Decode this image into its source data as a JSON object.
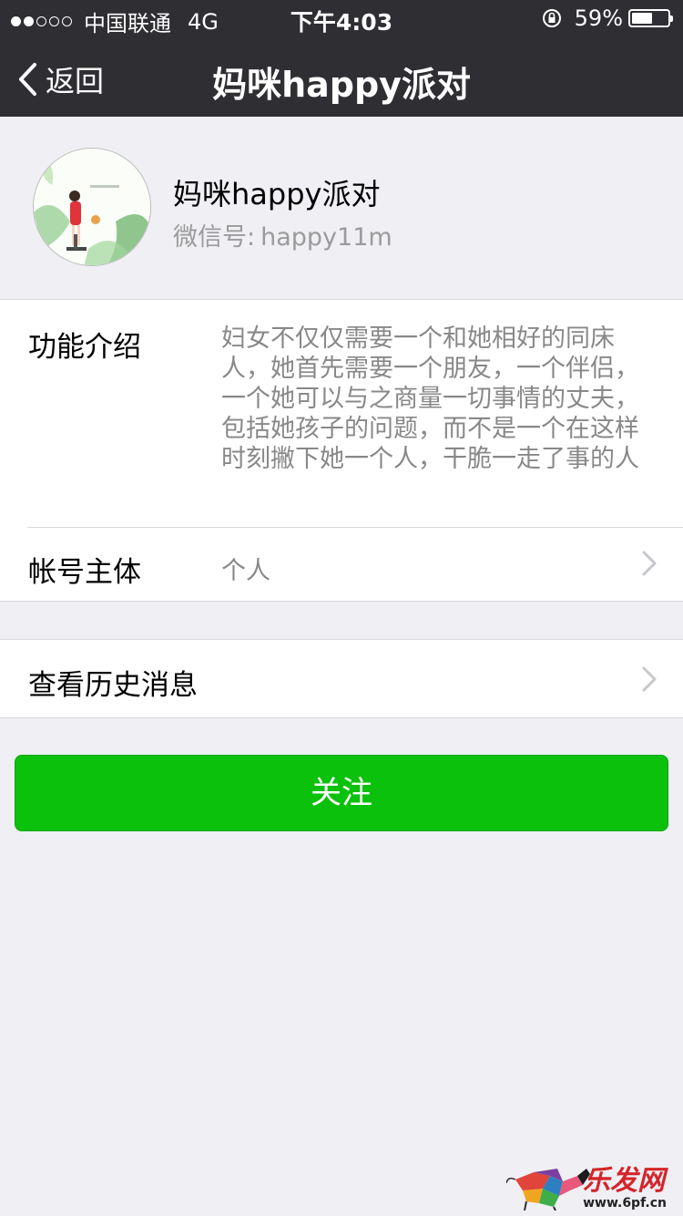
{
  "status_bar": {
    "signal_dots": [
      true,
      true,
      false,
      false,
      false
    ],
    "carrier": "中国联通",
    "network": "4G",
    "time": "下午4:03",
    "battery_percent_text": "59%",
    "battery_level": 0.59
  },
  "nav": {
    "back_label": "返回",
    "title": "妈咪happy派对"
  },
  "profile": {
    "name": "妈咪happy派对",
    "id_label": "微信号:",
    "id_value": "happy11m"
  },
  "info": {
    "intro_label": "功能介绍",
    "intro_text": "妇女不仅仅需要一个和她相好的同床人，她首先需要一个朋友，一个伴侣，一个她可以与之商量一切事情的丈夫，包括她孩子的问题，而不是一个在这样时刻撇下她一个人，干脆一走了事的人",
    "owner_label": "帐号主体",
    "owner_value": "个人"
  },
  "history": {
    "label": "查看历史消息"
  },
  "follow_button": {
    "label": "关注"
  },
  "watermark": {
    "brand": "乐发网",
    "url": "www.6pf.cn"
  },
  "colors": {
    "nav_bg": "#2e2e33",
    "page_bg": "#efeff4",
    "primary_green": "#0bc10c",
    "secondary_text": "#888888"
  }
}
